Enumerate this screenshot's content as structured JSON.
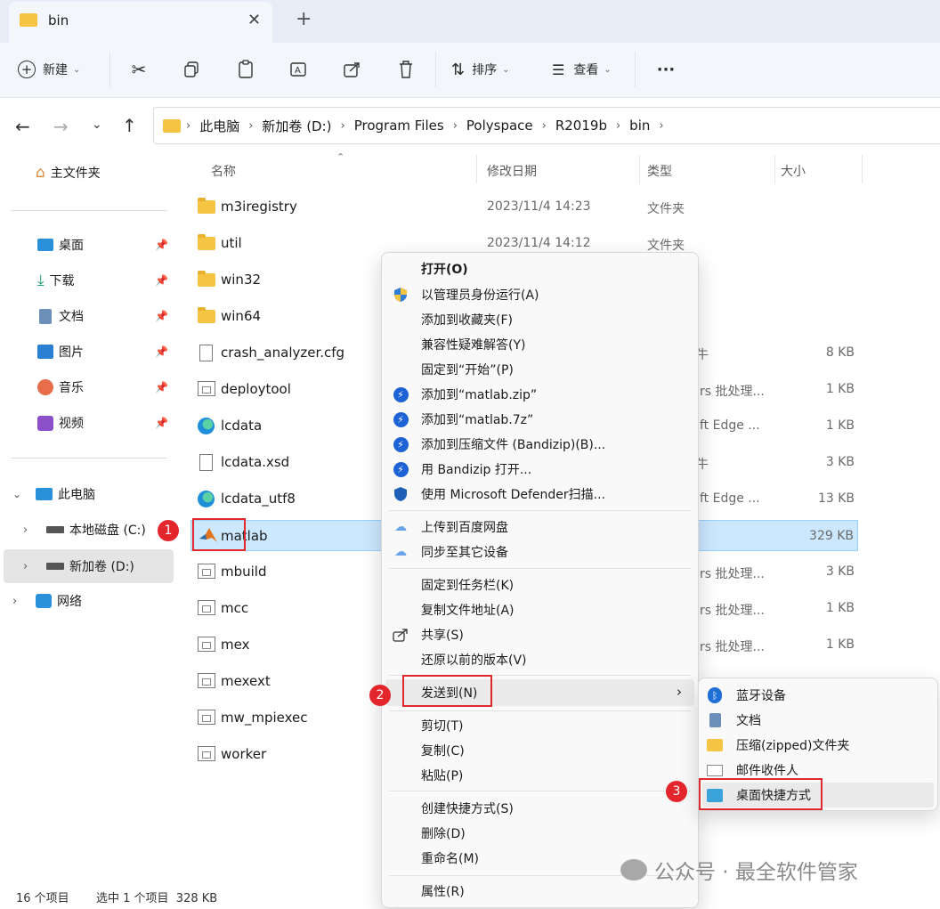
{
  "window": {
    "tab_title": "bin"
  },
  "toolbar": {
    "new_label": "新建",
    "sort_label": "排序",
    "view_label": "查看"
  },
  "address": {
    "crumbs": [
      "此电脑",
      "新加卷 (D:)",
      "Program Files",
      "Polyspace",
      "R2019b",
      "bin"
    ]
  },
  "sidebar": {
    "home": "主文件夹",
    "quick": [
      "桌面",
      "下载",
      "文档",
      "图片",
      "音乐",
      "视频"
    ],
    "this_pc": "此电脑",
    "drives": [
      "本地磁盘 (C:)",
      "新加卷 (D:)"
    ],
    "network": "网络"
  },
  "columns": {
    "name": "名称",
    "date": "修改日期",
    "type": "类型",
    "size": "大小"
  },
  "files": [
    {
      "name": "m3iregistry",
      "date": "2023/11/4 14:23",
      "type": "文件夹",
      "size": ""
    },
    {
      "name": "util",
      "date": "2023/11/4 14:12",
      "type": "文件夹",
      "size": ""
    },
    {
      "name": "win32",
      "date": "",
      "type": "",
      "size": ""
    },
    {
      "name": "win64",
      "date": "",
      "type": "",
      "size": ""
    },
    {
      "name": "crash_analyzer.cfg",
      "date": "",
      "type": "牛",
      "size": "8 KB"
    },
    {
      "name": "deploytool",
      "date": "",
      "type": "rs 批处理...",
      "size": "1 KB"
    },
    {
      "name": "lcdata",
      "date": "",
      "type": "ft Edge ...",
      "size": "1 KB"
    },
    {
      "name": "lcdata.xsd",
      "date": "",
      "type": "牛",
      "size": "3 KB"
    },
    {
      "name": "lcdata_utf8",
      "date": "",
      "type": "ft Edge ...",
      "size": "13 KB"
    },
    {
      "name": "matlab",
      "date": "",
      "type": "",
      "size": "329 KB"
    },
    {
      "name": "mbuild",
      "date": "",
      "type": "rs 批处理...",
      "size": "3 KB"
    },
    {
      "name": "mcc",
      "date": "",
      "type": "rs 批处理...",
      "size": "1 KB"
    },
    {
      "name": "mex",
      "date": "",
      "type": "rs 批处理...",
      "size": "1 KB"
    },
    {
      "name": "mexext",
      "date": "",
      "type": "",
      "size": ""
    },
    {
      "name": "mw_mpiexec",
      "date": "",
      "type": "",
      "size": ""
    },
    {
      "name": "worker",
      "date": "",
      "type": "",
      "size": ""
    }
  ],
  "context_menu": {
    "open": "打开(O)",
    "run_admin": "以管理员身份运行(A)",
    "add_fav": "添加到收藏夹(F)",
    "compat": "兼容性疑难解答(Y)",
    "pin_start": "固定到“开始”(P)",
    "add_zip": "添加到“matlab.zip”",
    "add_7z": "添加到“matlab.7z”",
    "add_archive": "添加到压缩文件 (Bandizip)(B)...",
    "open_bz": "用 Bandizip 打开...",
    "defender": "使用 Microsoft Defender扫描...",
    "baidu": "上传到百度网盘",
    "sync": "同步至其它设备",
    "pin_taskbar": "固定到任务栏(K)",
    "copy_path": "复制文件地址(A)",
    "share": "共享(S)",
    "restore": "还原以前的版本(V)",
    "send_to": "发送到(N)",
    "cut": "剪切(T)",
    "copy": "复制(C)",
    "paste": "粘贴(P)",
    "shortcut": "创建快捷方式(S)",
    "delete": "删除(D)",
    "rename": "重命名(M)",
    "props": "属性(R)"
  },
  "send_to_menu": {
    "bluetooth": "蓝牙设备",
    "documents": "文档",
    "zip": "压缩(zipped)文件夹",
    "mail": "邮件收件人",
    "desktop": "桌面快捷方式"
  },
  "annotations": {
    "b1": "1",
    "b2": "2",
    "b3": "3"
  },
  "status": {
    "count": "16 个项目",
    "selected": "选中 1 个项目  328 KB"
  },
  "watermark": "公众号 · 最全软件管家",
  "colors": {
    "selection": "#cce8ff",
    "accent": "#0067c0",
    "annotation_red": "#e3262b"
  }
}
